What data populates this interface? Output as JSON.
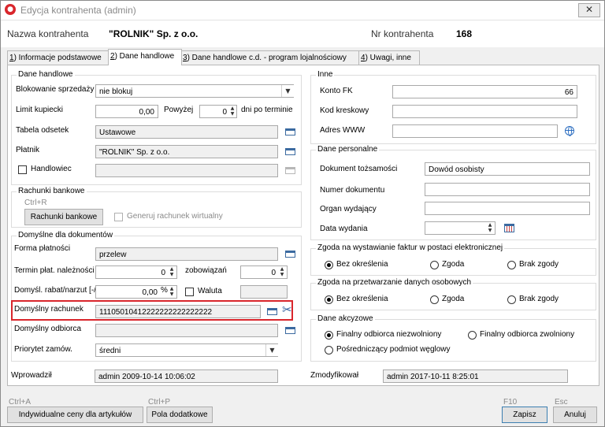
{
  "window": {
    "title": "Edycja kontrahenta (admin)",
    "close_glyph": "✕"
  },
  "header": {
    "name_label": "Nazwa kontrahenta",
    "name_value": "\"ROLNIK\" Sp. z o.o.",
    "nr_label": "Nr kontrahenta",
    "nr_value": "168"
  },
  "tabs": [
    {
      "key": "1",
      "label": "Informacje podstawowe"
    },
    {
      "key": "2",
      "label": "Dane handlowe"
    },
    {
      "key": "3",
      "label": "Dane handlowe c.d. - program lojalnościowy"
    },
    {
      "key": "4",
      "label": "Uwagi, inne"
    }
  ],
  "dane_handlowe": {
    "title": "Dane handlowe",
    "blokowanie_label": "Blokowanie sprzedaży",
    "blokowanie_value": "nie blokuj",
    "limit_label": "Limit kupiecki",
    "limit_value": "0,00",
    "powyzej_label": "Powyżej",
    "powyzej_value": "0",
    "dni_label": "dni po terminie",
    "tabela_label": "Tabela odsetek",
    "tabela_value": "Ustawowe",
    "platnik_label": "Płatnik",
    "platnik_value": "\"ROLNIK\" Sp. z o.o.",
    "handlowiec_label": "Handlowiec",
    "handlowiec_value": ""
  },
  "rachunki": {
    "title": "Rachunki bankowe",
    "shortcut": "Ctrl+R",
    "button_label": "Rachunki bankowe",
    "generuj_label": "Generuj rachunek wirtualny"
  },
  "domyslne": {
    "title": "Domyślne dla dokumentów",
    "forma_label": "Forma płatności",
    "forma_value": "przelew",
    "termin_label": "Termin płat. należności",
    "termin_value": "0",
    "zobowiazan_label": "zobowiązań",
    "zobowiazan_value": "0",
    "rabat_label": "Domyśl. rabat/narzut [-/+]",
    "rabat_value": "0,00",
    "waluta_label": "Waluta",
    "waluta_value": "",
    "rachunek_label": "Domyślny rachunek",
    "rachunek_value": "11105010412222222222222222",
    "odbiorca_label": "Domyślny odbiorca",
    "odbiorca_value": "",
    "priorytet_label": "Priorytet zamów.",
    "priorytet_value": "średni"
  },
  "inne": {
    "title": "Inne",
    "konto_label": "Konto FK",
    "konto_value": "66",
    "kod_label": "Kod kreskowy",
    "kod_value": "",
    "www_label": "Adres WWW",
    "www_value": ""
  },
  "personalne": {
    "title": "Dane personalne",
    "dokument_label": "Dokument tożsamości",
    "dokument_value": "Dowód osobisty",
    "numer_label": "Numer dokumentu",
    "numer_value": "",
    "organ_label": "Organ wydający",
    "organ_value": "",
    "data_label": "Data wydania",
    "data_value": ""
  },
  "zgoda_faktur": {
    "title": "Zgoda na wystawianie faktur w postaci elektronicznej",
    "options": [
      "Bez określenia",
      "Zgoda",
      "Brak zgody"
    ],
    "selected": 0
  },
  "zgoda_dane": {
    "title": "Zgoda na przetwarzanie danych osobowych",
    "options": [
      "Bez określenia",
      "Zgoda",
      "Brak zgody"
    ],
    "selected": 0
  },
  "akcyzowe": {
    "title": "Dane akcyzowe",
    "options": [
      "Finalny odbiorca niezwolniony",
      "Finalny odbiorca zwolniony",
      "Pośredniczący podmiot węglowy"
    ],
    "selected": 0
  },
  "audit": {
    "wprowadzil_label": "Wprowadził",
    "wprowadzil_value": "admin 2009-10-14 10:06:02",
    "zmodyfikowal_label": "Zmodyfikował",
    "zmodyfikowal_value": "admin 2017-10-11  8:25:01"
  },
  "footer": {
    "ceny_shortcut": "Ctrl+A",
    "ceny_label": "Indywidualne ceny dla artykułów",
    "pola_shortcut": "Ctrl+P",
    "pola_label": "Pola dodatkowe",
    "zapisz_shortcut": "F10",
    "zapisz_label": "Zapisz",
    "anuluj_shortcut": "Esc",
    "anuluj_label": "Anuluj"
  },
  "colors": {
    "highlight": "#d9262c",
    "accent": "#3b6aa0"
  }
}
